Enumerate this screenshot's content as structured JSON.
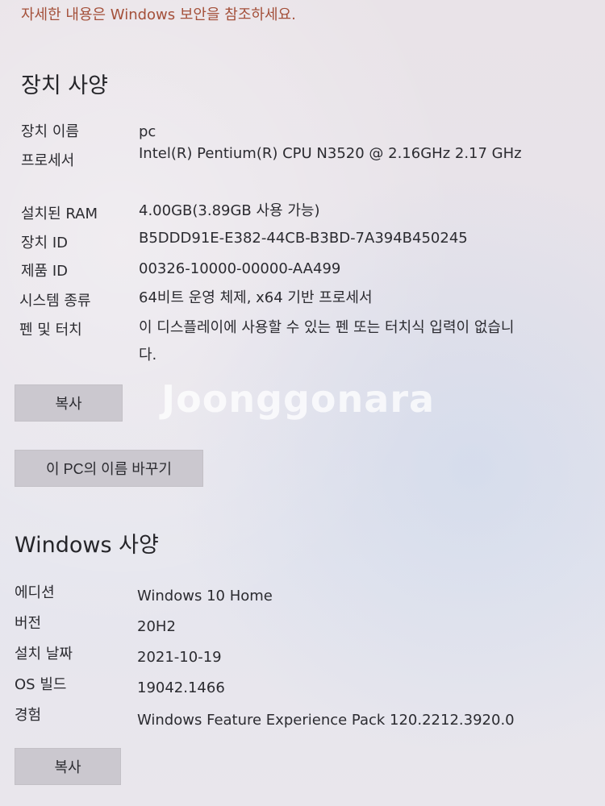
{
  "top_link": "자세한 내용은 Windows 보안을 참조하세요.",
  "device_specs": {
    "title": "장치 사양",
    "items": [
      {
        "label": "장치 이름",
        "value": "pc"
      },
      {
        "label": "프로세서",
        "value": "Intel(R) Pentium(R) CPU  N3520  @ 2.16GHz   2.17 GHz"
      },
      {
        "label": "설치된 RAM",
        "value": "4.00GB(3.89GB 사용 가능)"
      },
      {
        "label": "장치 ID",
        "value": "B5DDD91E-E382-44CB-B3BD-7A394B450245"
      },
      {
        "label": "제품 ID",
        "value": "00326-10000-00000-AA499"
      },
      {
        "label": "시스템 종류",
        "value": "64비트 운영 체제, x64 기반 프로세서"
      },
      {
        "label": "펜 및 터치",
        "value": "이 디스플레이에 사용할 수 있는 펜 또는 터치식 입력이 없습니다."
      }
    ],
    "copy_label": "복사",
    "rename_label": "이 PC의 이름 바꾸기"
  },
  "windows_specs": {
    "title": "Windows 사양",
    "items": [
      {
        "label": "에디션",
        "value": "Windows 10 Home"
      },
      {
        "label": "버전",
        "value": "20H2"
      },
      {
        "label": "설치 날짜",
        "value": "2021-10-19"
      },
      {
        "label": "OS 빌드",
        "value": "19042.1466"
      },
      {
        "label": "경험",
        "value": "Windows Feature Experience Pack 120.2212.3920.0"
      }
    ],
    "copy_label": "복사"
  },
  "watermark": "Joonggonara",
  "colors": {
    "link": "#a4503a",
    "button_bg": "#cbc8cf",
    "text": "#2b2b30"
  }
}
